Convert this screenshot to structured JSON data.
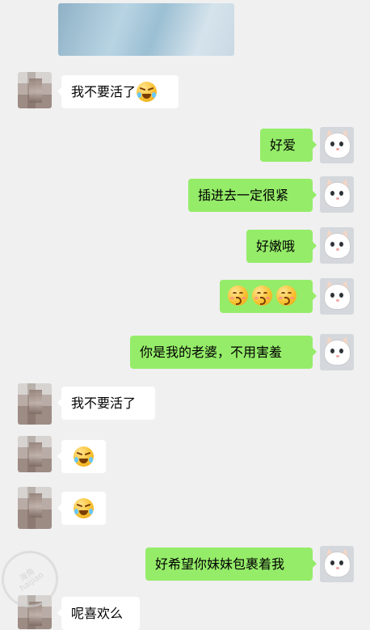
{
  "messages": [
    {
      "side": "left",
      "text": "我不要活了",
      "emoji": "cry"
    },
    {
      "side": "right",
      "text": "好爱"
    },
    {
      "side": "right",
      "text": "插进去一定很紧"
    },
    {
      "side": "right",
      "text": "好嫩哦"
    },
    {
      "side": "right",
      "emoji_row": [
        "kiss",
        "kiss",
        "kiss"
      ]
    },
    {
      "side": "right",
      "text": "你是我的老婆，不用害羞"
    },
    {
      "side": "left",
      "text": "我不要活了"
    },
    {
      "side": "left",
      "emoji": "cry"
    },
    {
      "side": "left",
      "emoji": "cry"
    },
    {
      "side": "right",
      "text": "好希望你妹妹包裹着我"
    },
    {
      "side": "left",
      "text": "呢喜欢么"
    }
  ],
  "watermark": {
    "line1": "海角",
    "line2": "haijiao"
  },
  "colors": {
    "background": "#f0f0f0",
    "incoming_bubble": "#ffffff",
    "outgoing_bubble": "#95ec69"
  }
}
